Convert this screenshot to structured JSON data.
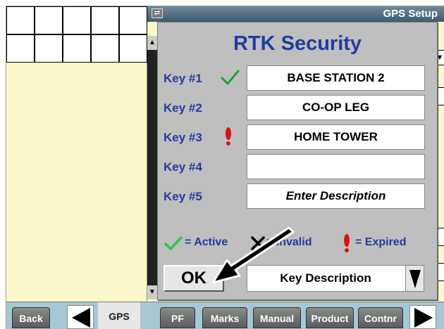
{
  "window": {
    "title": "GPS Setup"
  },
  "dialog": {
    "title": "RTK Security",
    "keys": [
      {
        "label": "Key #1",
        "value": "BASE STATION 2",
        "status": "active"
      },
      {
        "label": "Key #2",
        "value": "CO-OP LEG",
        "status": "none"
      },
      {
        "label": "Key #3",
        "value": "HOME TOWER",
        "status": "expired"
      },
      {
        "label": "Key #4",
        "value": "",
        "status": "none"
      },
      {
        "label": "Key #5",
        "value": "",
        "placeholder": "Enter Description",
        "status": "none"
      }
    ],
    "legend": {
      "active": "= Active",
      "invalid": "= Invalid",
      "expired": "= Expired"
    },
    "ok_label": "OK",
    "description_select": {
      "value": "Key Description"
    }
  },
  "bottom_bar": {
    "back": "Back",
    "gps": "GPS",
    "pf": "PF",
    "marks": "Marks",
    "manual": "Manual",
    "product": "Product",
    "contnr": "Contnr"
  },
  "colors": {
    "accent_text": "#1f3da0",
    "active_check": "#36c24a",
    "expired_mark": "#e01010",
    "background_yellow": "#fbf7c9",
    "bottom_bar": "#a6c8d6"
  },
  "icons": [
    "checkmark-icon",
    "x-icon",
    "exclamation-icon",
    "dropdown-arrow-icon",
    "left-arrow-icon",
    "right-arrow-icon",
    "pointer-arrow-icon"
  ]
}
